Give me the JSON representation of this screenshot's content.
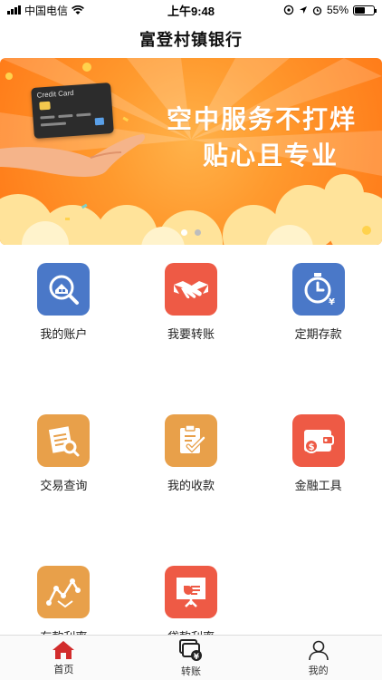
{
  "status_bar": {
    "carrier": "中国电信",
    "time": "上午9:48",
    "battery": "55%",
    "battery_level": 0.55,
    "icons": [
      "signal-icon",
      "wifi-icon",
      "location-lock-icon",
      "location-arrow-icon",
      "alarm-icon",
      "battery-icon"
    ]
  },
  "header": {
    "title": "富登村镇银行"
  },
  "banner": {
    "line1": "空中服务不打烊",
    "line2": "贴心且专业",
    "card_label": "Credit Card",
    "slides": 2,
    "active_slide": 1
  },
  "menu": {
    "items": [
      {
        "label": "我的账户",
        "icon": "account-search-icon",
        "color": "#4a78c8"
      },
      {
        "label": "我要转账",
        "icon": "handshake-icon",
        "color": "#ee5a45"
      },
      {
        "label": "定期存款",
        "icon": "stopwatch-yen-icon",
        "color": "#4a78c8"
      },
      {
        "label": "交易查询",
        "icon": "notes-search-icon",
        "color": "#e8a04a"
      },
      {
        "label": "我的收款",
        "icon": "clipboard-check-icon",
        "color": "#e8a04a"
      },
      {
        "label": "金融工具",
        "icon": "wallet-dollar-icon",
        "color": "#ee5a45"
      },
      {
        "label": "存款利率",
        "icon": "trend-chart-icon",
        "color": "#e8a04a"
      },
      {
        "label": "贷款利率",
        "icon": "presentation-board-icon",
        "color": "#ee5a45"
      }
    ]
  },
  "tab_bar": {
    "tabs": [
      {
        "label": "首页",
        "icon": "home-icon",
        "active": true
      },
      {
        "label": "转账",
        "icon": "transfer-icon",
        "active": false
      },
      {
        "label": "我的",
        "icon": "user-icon",
        "active": false
      }
    ],
    "active_color": "#d22c2c"
  }
}
